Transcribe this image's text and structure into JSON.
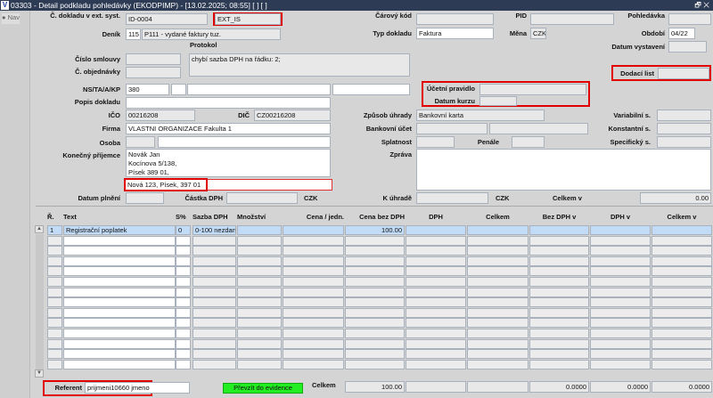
{
  "window": {
    "title": "03303 - Detail podkladu pohledávky (EKODPIMP) - [13.02.2025; 08:55]  [ ]  [ ]",
    "controls": "🗗 ✕",
    "nav": "Nav"
  },
  "header": {
    "ext_doc_label": "Č. dokladu v ext. syst.",
    "ext_doc_id": "ID-0004",
    "ext_system": "EXT_IS",
    "journal_label": "Deník",
    "journal_code": "115",
    "journal_name": "P111 - vydané faktury tuz.",
    "protocol_label": "Protokol",
    "protocol_text": "chybí sazba DPH na řádku: 2;",
    "contract_label": "Číslo smlouvy",
    "order_label": "Č. objednávky",
    "ns_label": "NS/TA/A/KP",
    "ns_value": "380",
    "description_label": "Popis dokladu",
    "ico_label": "IČO",
    "ico": "00216208",
    "dic_label": "DIČ",
    "dic": "CZ00216208",
    "company_label": "Firma",
    "company": "VLASTNI ORGANIZACE Fakulta 1",
    "person_label": "Osoba",
    "recipient_label": "Konečný příjemce",
    "recipient_lines": [
      "Novák Jan",
      "Kocínova 5/138,",
      "Písek 389 01,"
    ],
    "recipient_address2": "Nová 123, Písek, 397 01",
    "performance_date_label": "Datum plnění",
    "vat_amount_label": "Částka DPH",
    "currency_czk": "CZK",
    "barcode_label": "Čárový kód",
    "pid_label": "PID",
    "receivable_label": "Pohledávka",
    "doc_type_label": "Typ dokladu",
    "doc_type": "Faktura",
    "currency_label": "Měna",
    "currency": "CZK",
    "period_label": "Období",
    "period": "04/22",
    "issue_date_label": "Datum vystavení",
    "delivery_note_label": "Dodací list",
    "accounting_rule_label": "Účetní pravidlo",
    "rate_date_label": "Datum kurzu",
    "payment_method_label": "Způsob úhrady",
    "payment_method": "Bankovní karta",
    "bank_account_label": "Bankovní účet",
    "due_label": "Splatnost",
    "penalty_label": "Penále",
    "variable_symbol_label": "Variabilní s.",
    "constant_symbol_label": "Konstantní s.",
    "specific_symbol_label": "Specifický s.",
    "message_label": "Zpráva",
    "to_pay_label": "K úhradě",
    "total_in_label": "Celkem v",
    "total_in_value": "0.00"
  },
  "table": {
    "columns": [
      "Ř.",
      "Text",
      "S%",
      "Sazba DPH",
      "Množství",
      "Cena / jedn.",
      "Cena bez DPH",
      "DPH",
      "Celkem",
      "Bez DPH v",
      "DPH v",
      "Celkem v"
    ],
    "rows": [
      [
        "1",
        "Registrační poplatek",
        "0",
        "0-100 nezdan",
        "",
        "",
        "100.00",
        "",
        "",
        "",
        "",
        ""
      ]
    ],
    "empty_rows": 13
  },
  "footer": {
    "referent_label": "Referent",
    "referent": "prijmeni10660 jmeno",
    "transfer_button": "Převzít do evidence",
    "total_label": "Celkem",
    "totals": [
      "100.00",
      "",
      "",
      "0.0000",
      "0.0000",
      "0.0000"
    ]
  }
}
